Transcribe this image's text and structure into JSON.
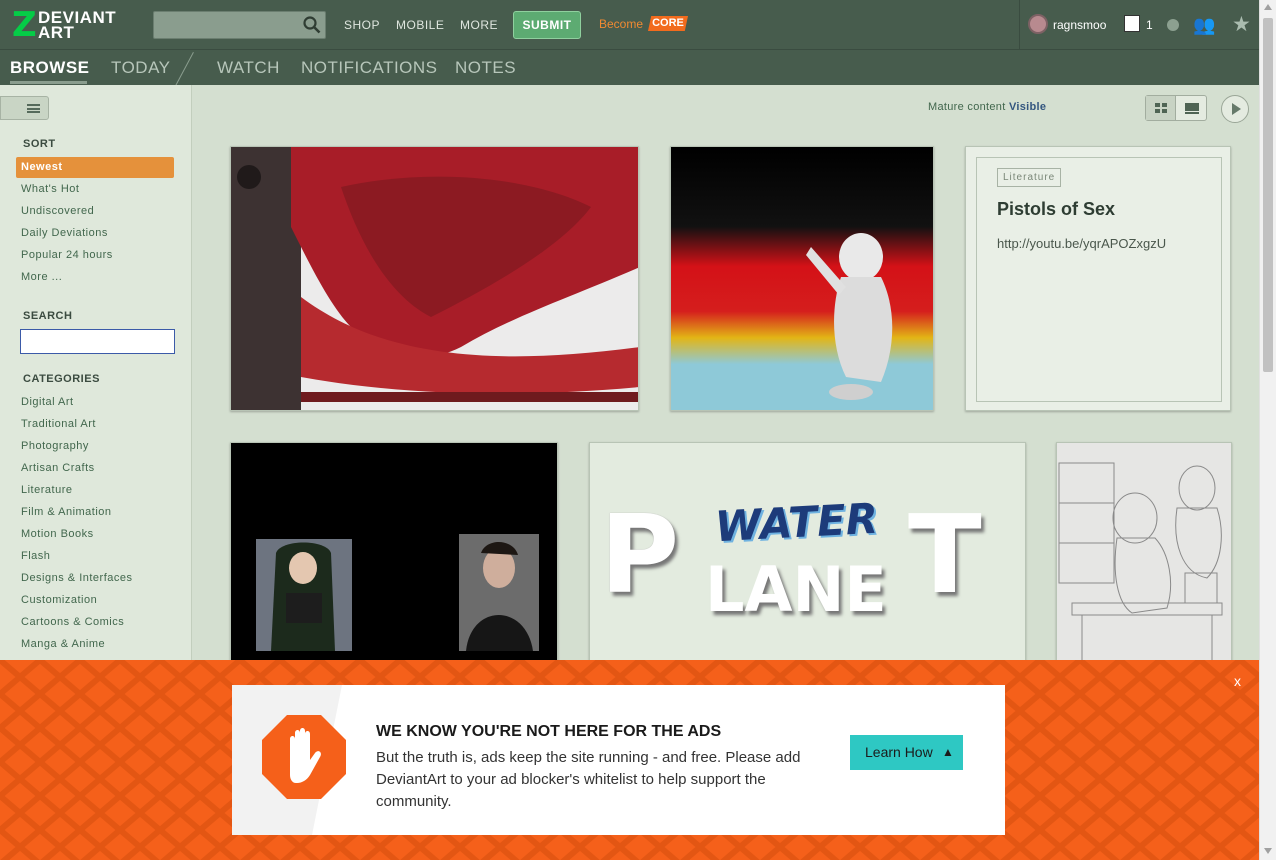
{
  "brand": {
    "logo_line1": "DEVIANT",
    "logo_line2": "ART",
    "logo_glyph": "Z"
  },
  "topnav": {
    "search_placeholder": "",
    "links": [
      "SHOP",
      "MOBILE",
      "MORE"
    ],
    "submit_label": "SUBMIT",
    "become_label": "Become",
    "core_label": "CORE"
  },
  "user": {
    "name": "ragnsmoo",
    "message_count": "1"
  },
  "tabs": [
    {
      "label": "BROWSE",
      "active": true
    },
    {
      "label": "TODAY",
      "active": false
    },
    {
      "label": "WATCH",
      "active": false
    },
    {
      "label": "NOTIFICATIONS",
      "active": false
    },
    {
      "label": "NOTES",
      "active": false
    }
  ],
  "sidebar": {
    "sort_heading": "SORT",
    "sort_items": [
      "Newest",
      "What's Hot",
      "Undiscovered",
      "Daily Deviations",
      "Popular 24 hours",
      "More ..."
    ],
    "search_heading": "SEARCH",
    "search_value": "",
    "categories_heading": "CATEGORIES",
    "categories": [
      "Digital Art",
      "Traditional Art",
      "Photography",
      "Artisan Crafts",
      "Literature",
      "Film & Animation",
      "Motion Books",
      "Flash",
      "Designs & Interfaces",
      "Customization",
      "Cartoons & Comics",
      "Manga & Anime"
    ]
  },
  "main": {
    "mature_label": "Mature content",
    "mature_value": "Visible",
    "literature": {
      "tag": "Literature",
      "title": "Pistols of Sex",
      "link": "http://youtu.be/yqrAPOZxgzU"
    },
    "water_planet": {
      "word1": "WATER",
      "word2_a": "P",
      "word2_b": "LANE",
      "word2_c": "T"
    }
  },
  "ad": {
    "close": "x",
    "title": "WE KNOW YOU'RE NOT HERE FOR THE ADS",
    "body": "But the truth is, ads keep the site running - and free. Please add DeviantArt to your ad blocker's whitelist to help support the community.",
    "button": "Learn How"
  },
  "colors": {
    "topbar": "#475c4d",
    "accent_green": "#05cc47",
    "sort_selected": "#e5913b",
    "ad_orange": "#f5601a",
    "ad_button": "#2ec8c3"
  }
}
